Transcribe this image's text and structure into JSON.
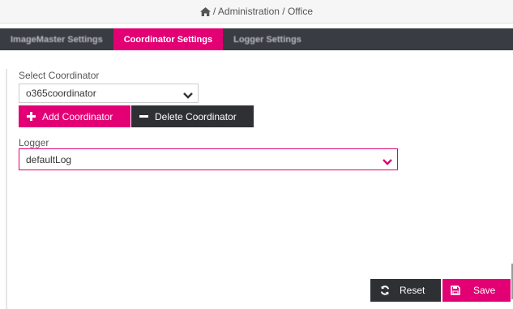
{
  "breadcrumb": {
    "text": "/ Administration / Office"
  },
  "tabs": [
    {
      "label": "ImageMaster Settings"
    },
    {
      "label": "Coordinator Settings"
    },
    {
      "label": "Logger Settings"
    }
  ],
  "coordinator": {
    "label": "Select Coordinator",
    "selected": "o365coordinator",
    "add_label": "Add Coordinator",
    "delete_label": "Delete Coordinator"
  },
  "logger": {
    "label": "Logger",
    "selected": "defaultLog"
  },
  "footer": {
    "reset_label": "Reset",
    "save_label": "Save"
  },
  "colors": {
    "accent": "#e20074",
    "dark": "#2e3034",
    "tabbar": "#3a3c43"
  }
}
